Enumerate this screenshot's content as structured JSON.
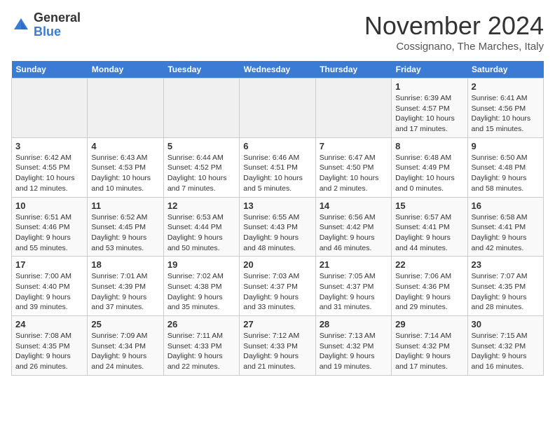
{
  "header": {
    "logo": {
      "general": "General",
      "blue": "Blue"
    },
    "title": "November 2024",
    "subtitle": "Cossignano, The Marches, Italy"
  },
  "weekdays": [
    "Sunday",
    "Monday",
    "Tuesday",
    "Wednesday",
    "Thursday",
    "Friday",
    "Saturday"
  ],
  "weeks": [
    [
      {
        "day": "",
        "info": ""
      },
      {
        "day": "",
        "info": ""
      },
      {
        "day": "",
        "info": ""
      },
      {
        "day": "",
        "info": ""
      },
      {
        "day": "",
        "info": ""
      },
      {
        "day": "1",
        "info": "Sunrise: 6:39 AM\nSunset: 4:57 PM\nDaylight: 10 hours and 17 minutes."
      },
      {
        "day": "2",
        "info": "Sunrise: 6:41 AM\nSunset: 4:56 PM\nDaylight: 10 hours and 15 minutes."
      }
    ],
    [
      {
        "day": "3",
        "info": "Sunrise: 6:42 AM\nSunset: 4:55 PM\nDaylight: 10 hours and 12 minutes."
      },
      {
        "day": "4",
        "info": "Sunrise: 6:43 AM\nSunset: 4:53 PM\nDaylight: 10 hours and 10 minutes."
      },
      {
        "day": "5",
        "info": "Sunrise: 6:44 AM\nSunset: 4:52 PM\nDaylight: 10 hours and 7 minutes."
      },
      {
        "day": "6",
        "info": "Sunrise: 6:46 AM\nSunset: 4:51 PM\nDaylight: 10 hours and 5 minutes."
      },
      {
        "day": "7",
        "info": "Sunrise: 6:47 AM\nSunset: 4:50 PM\nDaylight: 10 hours and 2 minutes."
      },
      {
        "day": "8",
        "info": "Sunrise: 6:48 AM\nSunset: 4:49 PM\nDaylight: 10 hours and 0 minutes."
      },
      {
        "day": "9",
        "info": "Sunrise: 6:50 AM\nSunset: 4:48 PM\nDaylight: 9 hours and 58 minutes."
      }
    ],
    [
      {
        "day": "10",
        "info": "Sunrise: 6:51 AM\nSunset: 4:46 PM\nDaylight: 9 hours and 55 minutes."
      },
      {
        "day": "11",
        "info": "Sunrise: 6:52 AM\nSunset: 4:45 PM\nDaylight: 9 hours and 53 minutes."
      },
      {
        "day": "12",
        "info": "Sunrise: 6:53 AM\nSunset: 4:44 PM\nDaylight: 9 hours and 50 minutes."
      },
      {
        "day": "13",
        "info": "Sunrise: 6:55 AM\nSunset: 4:43 PM\nDaylight: 9 hours and 48 minutes."
      },
      {
        "day": "14",
        "info": "Sunrise: 6:56 AM\nSunset: 4:42 PM\nDaylight: 9 hours and 46 minutes."
      },
      {
        "day": "15",
        "info": "Sunrise: 6:57 AM\nSunset: 4:41 PM\nDaylight: 9 hours and 44 minutes."
      },
      {
        "day": "16",
        "info": "Sunrise: 6:58 AM\nSunset: 4:41 PM\nDaylight: 9 hours and 42 minutes."
      }
    ],
    [
      {
        "day": "17",
        "info": "Sunrise: 7:00 AM\nSunset: 4:40 PM\nDaylight: 9 hours and 39 minutes."
      },
      {
        "day": "18",
        "info": "Sunrise: 7:01 AM\nSunset: 4:39 PM\nDaylight: 9 hours and 37 minutes."
      },
      {
        "day": "19",
        "info": "Sunrise: 7:02 AM\nSunset: 4:38 PM\nDaylight: 9 hours and 35 minutes."
      },
      {
        "day": "20",
        "info": "Sunrise: 7:03 AM\nSunset: 4:37 PM\nDaylight: 9 hours and 33 minutes."
      },
      {
        "day": "21",
        "info": "Sunrise: 7:05 AM\nSunset: 4:37 PM\nDaylight: 9 hours and 31 minutes."
      },
      {
        "day": "22",
        "info": "Sunrise: 7:06 AM\nSunset: 4:36 PM\nDaylight: 9 hours and 29 minutes."
      },
      {
        "day": "23",
        "info": "Sunrise: 7:07 AM\nSunset: 4:35 PM\nDaylight: 9 hours and 28 minutes."
      }
    ],
    [
      {
        "day": "24",
        "info": "Sunrise: 7:08 AM\nSunset: 4:35 PM\nDaylight: 9 hours and 26 minutes."
      },
      {
        "day": "25",
        "info": "Sunrise: 7:09 AM\nSunset: 4:34 PM\nDaylight: 9 hours and 24 minutes."
      },
      {
        "day": "26",
        "info": "Sunrise: 7:11 AM\nSunset: 4:33 PM\nDaylight: 9 hours and 22 minutes."
      },
      {
        "day": "27",
        "info": "Sunrise: 7:12 AM\nSunset: 4:33 PM\nDaylight: 9 hours and 21 minutes."
      },
      {
        "day": "28",
        "info": "Sunrise: 7:13 AM\nSunset: 4:32 PM\nDaylight: 9 hours and 19 minutes."
      },
      {
        "day": "29",
        "info": "Sunrise: 7:14 AM\nSunset: 4:32 PM\nDaylight: 9 hours and 17 minutes."
      },
      {
        "day": "30",
        "info": "Sunrise: 7:15 AM\nSunset: 4:32 PM\nDaylight: 9 hours and 16 minutes."
      }
    ]
  ]
}
